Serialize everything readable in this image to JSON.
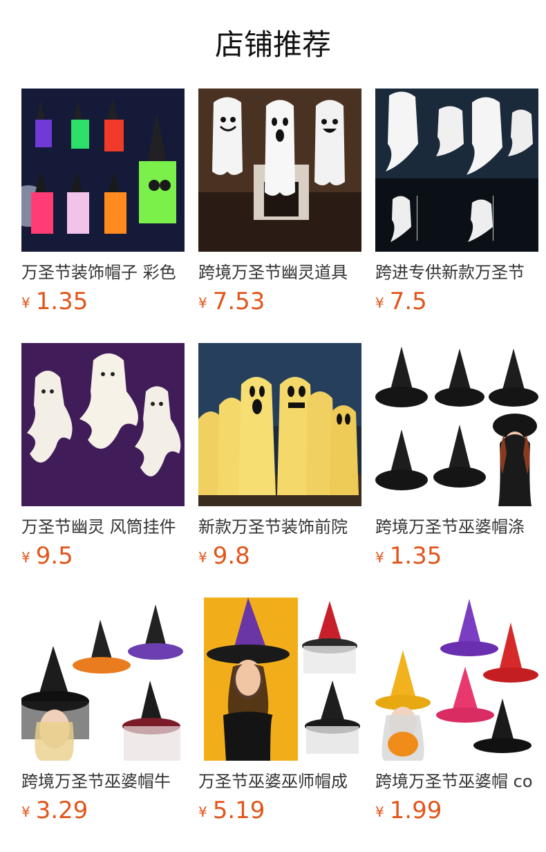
{
  "header": {
    "title": "店铺推荐"
  },
  "products": [
    {
      "name": "万圣节装饰帽子 彩色",
      "currency": "¥",
      "price": "1.35",
      "image": "witch-hat-lights-photo"
    },
    {
      "name": "跨境万圣节幽灵道具",
      "currency": "¥",
      "price": "7.53",
      "image": "three-ghosts-photo"
    },
    {
      "name": "跨进专供新款万圣节",
      "currency": "¥",
      "price": "7.5",
      "image": "ghost-windsock-size-photo"
    },
    {
      "name": "万圣节幽灵 风筒挂件",
      "currency": "¥",
      "price": "9.5",
      "image": "glowing-ghosts-photo"
    },
    {
      "name": "新款万圣节装饰前院",
      "currency": "¥",
      "price": "9.8",
      "image": "yellow-ghosts-yard-photo"
    },
    {
      "name": "跨境万圣节巫婆帽涤",
      "currency": "¥",
      "price": "1.35",
      "image": "black-witch-hats-photo"
    },
    {
      "name": "跨境万圣节巫婆帽牛",
      "currency": "¥",
      "price": "3.29",
      "image": "veiled-witch-hats-photo"
    },
    {
      "name": "万圣节巫婆巫师帽成",
      "currency": "¥",
      "price": "5.19",
      "image": "purple-witch-hat-model-photo"
    },
    {
      "name": "跨境万圣节巫婆帽 co",
      "currency": "¥",
      "price": "1.99",
      "image": "star-witch-hats-photo"
    }
  ],
  "colors": {
    "price": "#e2541a",
    "title": "#111111"
  }
}
